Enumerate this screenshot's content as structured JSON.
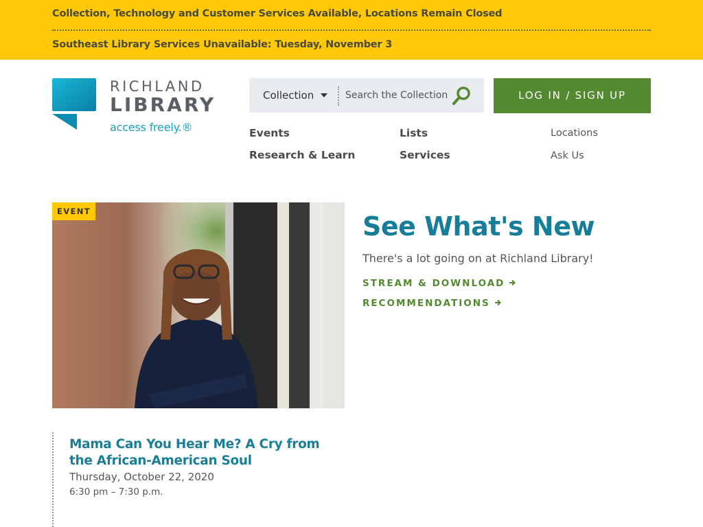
{
  "alerts": [
    "Collection, Technology and Customer Services Available, Locations Remain Closed",
    "Southeast Library Services Unavailable: Tuesday, November 3"
  ],
  "logo": {
    "name_line1": "RICHLAND",
    "name_line2": "LIBRARY",
    "tagline": "access freely.®"
  },
  "search": {
    "scope": "Collection",
    "placeholder": "Search the Collection"
  },
  "login_label": "LOG IN / SIGN UP",
  "nav": {
    "main": [
      "Events",
      "Lists",
      "Research & Learn",
      "Services"
    ],
    "utility": [
      "Locations",
      "Ask Us"
    ]
  },
  "event": {
    "badge": "EVENT",
    "title": "Mama Can You Hear Me? A Cry from the African-American Soul",
    "date": "Thursday, October 22, 2020",
    "time": "6:30 pm – 7:30 p.m."
  },
  "whats_new": {
    "heading": "See What's New",
    "subheading": "There's a lot going on at Richland Library!",
    "links": [
      "STREAM & DOWNLOAD",
      "RECOMMENDATIONS"
    ]
  },
  "colors": {
    "alert_bg": "#ffc907",
    "brand_teal": "#177e9a",
    "brand_green": "#53892f",
    "logo_teal": "#1a9fc0"
  },
  "icons": [
    "search-icon",
    "caret-down-icon",
    "arrow-right-icon",
    "library-logo-mark"
  ]
}
